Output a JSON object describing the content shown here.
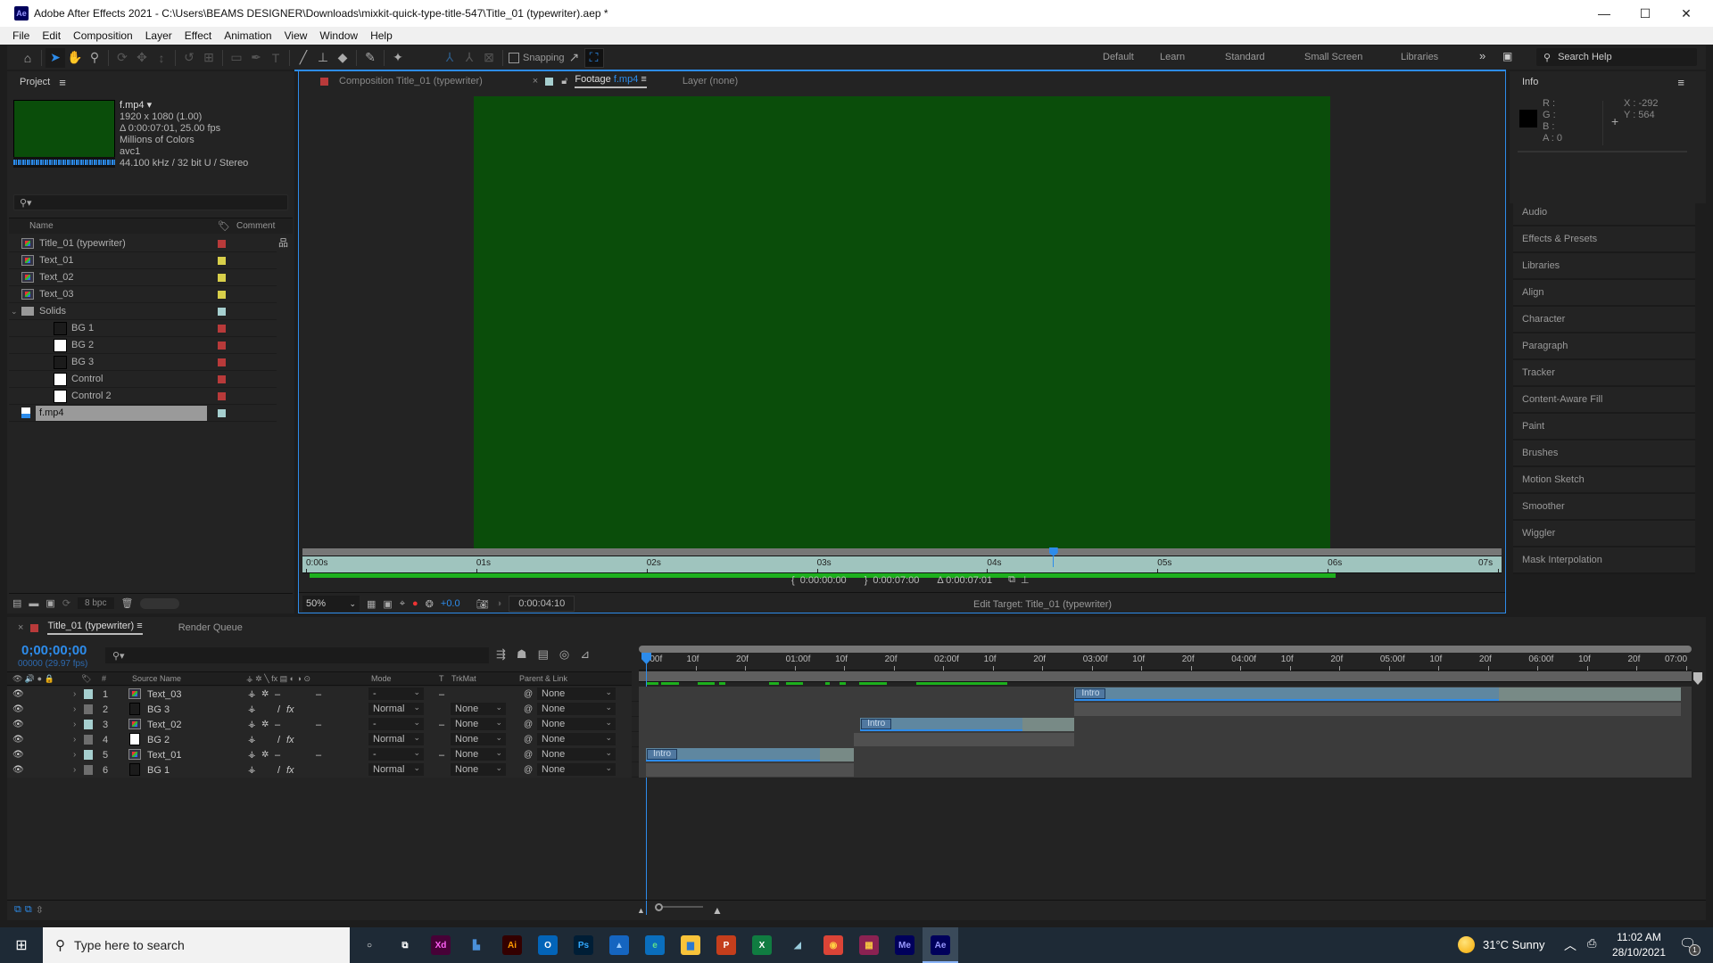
{
  "window": {
    "app_icon": "Ae",
    "title": "Adobe After Effects 2021 - C:\\Users\\BEAMS DESIGNER\\Downloads\\mixkit-quick-type-title-547\\Title_01 (typewriter).aep *",
    "minimize": "—",
    "maximize": "☐",
    "close": "✕"
  },
  "menu": [
    "File",
    "Edit",
    "Composition",
    "Layer",
    "Effect",
    "Animation",
    "View",
    "Window",
    "Help"
  ],
  "toolbar": {
    "snapping_label": "Snapping",
    "workspaces": [
      "Default",
      "Learn",
      "Standard",
      "Small Screen",
      "Libraries"
    ],
    "more": "»",
    "search_help_placeholder": "Search Help"
  },
  "project": {
    "title": "Project",
    "preview": {
      "name": "f.mp4",
      "resolution": "1920 x 1080 (1.00)",
      "duration": "Δ 0:00:07:01, 25.00 fps",
      "colors": "Millions of Colors",
      "codec": "avc1",
      "audio": "44.100 kHz / 32 bit U / Stereo"
    },
    "search_placeholder": "",
    "columns": {
      "name": "Name",
      "comment": "Comment"
    },
    "items": [
      {
        "name": "Title_01 (typewriter)",
        "type": "comp",
        "label": "#b83a3a",
        "indent": 0
      },
      {
        "name": "Text_01",
        "type": "comp",
        "label": "#d8cf4a",
        "indent": 0
      },
      {
        "name": "Text_02",
        "type": "comp",
        "label": "#d8cf4a",
        "indent": 0
      },
      {
        "name": "Text_03",
        "type": "comp",
        "label": "#d8cf4a",
        "indent": 0
      },
      {
        "name": "Solids",
        "type": "folder",
        "label": "#a6cfcf",
        "indent": 0
      },
      {
        "name": "BG 1",
        "type": "solid-dark",
        "label": "#b83a3a",
        "indent": 1
      },
      {
        "name": "BG 2",
        "type": "solid-white",
        "label": "#b83a3a",
        "indent": 1
      },
      {
        "name": "BG 3",
        "type": "solid-dark",
        "label": "#b83a3a",
        "indent": 1
      },
      {
        "name": "Control",
        "type": "solid-white",
        "label": "#b83a3a",
        "indent": 1
      },
      {
        "name": "Control 2",
        "type": "solid-white",
        "label": "#b83a3a",
        "indent": 1
      },
      {
        "name": "f.mp4",
        "type": "footage",
        "label": "#a6cfcf",
        "indent": 0,
        "selected": true
      }
    ],
    "bpc": "8 bpc"
  },
  "viewer": {
    "tabs": [
      {
        "label": "Composition Title_01 (typewriter)",
        "color": "#b83a3a"
      },
      {
        "label": "Footage",
        "sub": "f.mp4",
        "color": "#a6cfcf",
        "active": true
      },
      {
        "label": "Layer (none)"
      }
    ],
    "frame_color": "#0a4d0a",
    "ruler_labels": [
      "0:00s",
      "01s",
      "02s",
      "03s",
      "04s",
      "05s",
      "06s",
      "07s"
    ],
    "playhead_fraction": 0.627,
    "in_point": "0:00:00:00",
    "out_point": "0:00:07:00",
    "duration": "Δ 0:00:07:01",
    "zoom": "50%",
    "exposure": "+0.0",
    "current_time": "0:00:04:10",
    "edit_target": "Edit Target: Title_01 (typewriter)"
  },
  "info": {
    "title": "Info",
    "r": "R :",
    "g": "G :",
    "b": "B :",
    "a": "A :",
    "a_value": "0",
    "x": "X : -292",
    "y": "Y : 564"
  },
  "right_panels": [
    "Audio",
    "Effects & Presets",
    "Libraries",
    "Align",
    "Character",
    "Paragraph",
    "Tracker",
    "Content-Aware Fill",
    "Paint",
    "Brushes",
    "Motion Sketch",
    "Smoother",
    "Wiggler",
    "Mask Interpolation"
  ],
  "timeline": {
    "tab": "Title_01 (typewriter)",
    "render_queue": "Render Queue",
    "timecode": "0;00;00;00",
    "frame_info": "00000 (29.97 fps)",
    "columns": {
      "num": "#",
      "source": "Source Name",
      "mode": "Mode",
      "t": "T",
      "trkmat": "TrkMat",
      "parent": "Parent & Link"
    },
    "ruler_labels": [
      "0:00f",
      "10f",
      "20f",
      "01:00f",
      "10f",
      "20f",
      "02:00f",
      "10f",
      "20f",
      "03:00f",
      "10f",
      "20f",
      "04:00f",
      "10f",
      "20f",
      "05:00f",
      "10f",
      "20f",
      "06:00f",
      "10f",
      "20f",
      "07:00"
    ],
    "layers": [
      {
        "num": "1",
        "name": "Text_03",
        "type": "comp",
        "label": "#a6cfcf",
        "mode": "-",
        "trkmat": "",
        "parent": "None",
        "bar_start": 0.412,
        "bar_end": 0.995,
        "work_end": 0.82,
        "bar_kind": "comp",
        "marker": "Intro"
      },
      {
        "num": "2",
        "name": "BG 3",
        "type": "solid-dark",
        "label": "#6e6e6e",
        "mode": "Normal",
        "trkmat": "None",
        "parent": "None",
        "bar_start": 0.412,
        "bar_end": 0.995,
        "bar_kind": "solid"
      },
      {
        "num": "3",
        "name": "Text_02",
        "type": "comp",
        "label": "#a6cfcf",
        "mode": "-",
        "trkmat": "None",
        "parent": "None",
        "bar_start": 0.206,
        "bar_end": 0.412,
        "work_end": 0.362,
        "bar_kind": "comp",
        "marker": "Intro"
      },
      {
        "num": "4",
        "name": "BG 2",
        "type": "solid-white",
        "label": "#6e6e6e",
        "mode": "Normal",
        "trkmat": "None",
        "parent": "None",
        "bar_start": 0.2,
        "bar_end": 0.412,
        "bar_kind": "solid"
      },
      {
        "num": "5",
        "name": "Text_01",
        "type": "comp",
        "label": "#a6cfcf",
        "mode": "-",
        "trkmat": "None",
        "parent": "None",
        "bar_start": 0.0,
        "bar_end": 0.2,
        "work_end": 0.167,
        "bar_kind": "comp",
        "marker": "Intro"
      },
      {
        "num": "6",
        "name": "BG 1",
        "type": "solid-dark",
        "label": "#6e6e6e",
        "mode": "Normal",
        "trkmat": "None",
        "parent": "None",
        "bar_start": 0.0,
        "bar_end": 0.2,
        "bar_kind": "solid"
      }
    ]
  },
  "taskbar": {
    "search_placeholder": "Type here to search",
    "apps": [
      {
        "name": "cortana",
        "glyph": "○",
        "bg": "transparent",
        "fg": "#fff"
      },
      {
        "name": "task-view",
        "glyph": "⧉",
        "bg": "transparent",
        "fg": "#fff"
      },
      {
        "name": "adobe-xd",
        "glyph": "Xd",
        "bg": "#470137",
        "fg": "#ff61f6"
      },
      {
        "name": "app-blue",
        "glyph": "▙",
        "bg": "transparent",
        "fg": "#4a90d9"
      },
      {
        "name": "illustrator",
        "glyph": "Ai",
        "bg": "#330000",
        "fg": "#ff9a00"
      },
      {
        "name": "outlook",
        "glyph": "O",
        "bg": "#0364b8",
        "fg": "#fff"
      },
      {
        "name": "photoshop",
        "glyph": "Ps",
        "bg": "#001e36",
        "fg": "#31a8ff"
      },
      {
        "name": "photos",
        "glyph": "▲",
        "bg": "#1565c0",
        "fg": "#9cf"
      },
      {
        "name": "edge",
        "glyph": "e",
        "bg": "#0a6ebd",
        "fg": "#5fe08a"
      },
      {
        "name": "file-explorer",
        "glyph": "▆",
        "bg": "#f8c33a",
        "fg": "#2a78d0"
      },
      {
        "name": "powerpoint",
        "glyph": "P",
        "bg": "#c43e1c",
        "fg": "#fff"
      },
      {
        "name": "excel",
        "glyph": "X",
        "bg": "#107c41",
        "fg": "#fff"
      },
      {
        "name": "notes",
        "glyph": "◢",
        "bg": "transparent",
        "fg": "#9cd"
      },
      {
        "name": "chrome",
        "glyph": "◉",
        "bg": "#db4437",
        "fg": "#ffce44"
      },
      {
        "name": "winrar",
        "glyph": "▦",
        "bg": "#8b2252",
        "fg": "#f5c542"
      },
      {
        "name": "media-encoder",
        "glyph": "Me",
        "bg": "#00005b",
        "fg": "#9999ff"
      },
      {
        "name": "after-effects",
        "glyph": "Ae",
        "bg": "#00005b",
        "fg": "#9999ff",
        "active": true
      }
    ],
    "weather": "31°C  Sunny",
    "time": "11:02 AM",
    "date": "28/10/2021",
    "notifications": "1"
  }
}
